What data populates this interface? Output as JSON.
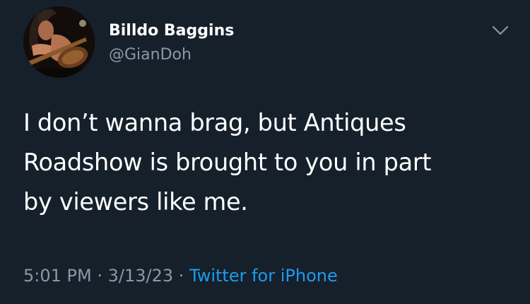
{
  "author": {
    "display_name": "Billdo Baggins",
    "handle": "@GianDoh",
    "avatar_icon": "profile-photo-avatar"
  },
  "tweet": {
    "lines": [
      "I don’t wanna brag, but Antiques",
      "Roadshow is brought to you in part",
      "by viewers like me."
    ]
  },
  "meta": {
    "time": "5:01 PM",
    "separator": " · ",
    "date": "3/13/23",
    "source": "Twitter for iPhone"
  },
  "menu": {
    "icon": "chevron-down-icon"
  },
  "colors": {
    "background": "#15202b",
    "primary_text": "#ffffff",
    "secondary_text": "#8b98a5",
    "link": "#1d9bf0"
  }
}
